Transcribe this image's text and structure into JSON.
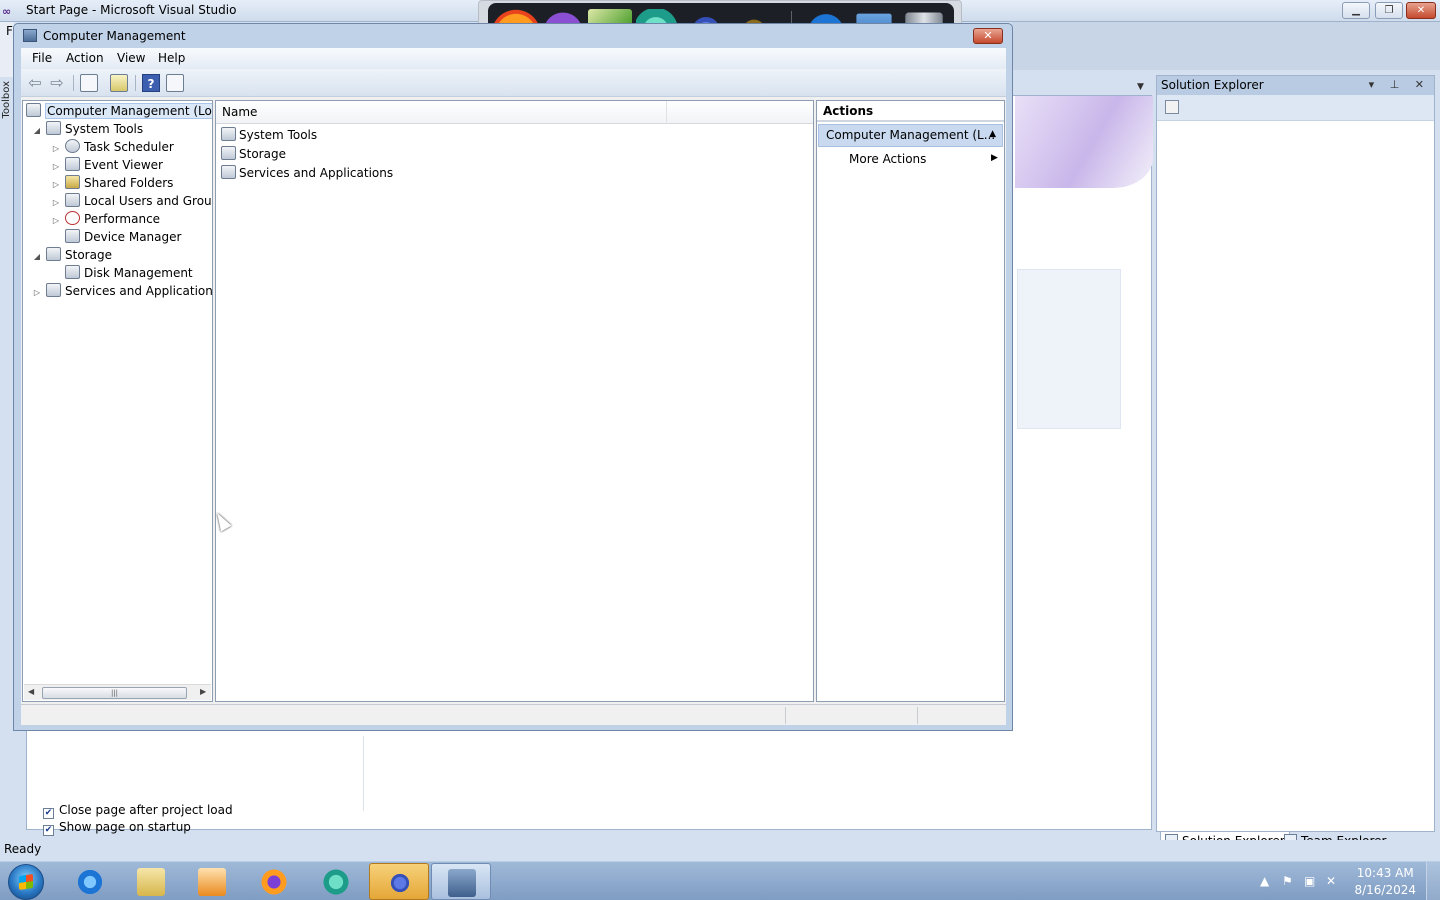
{
  "vs": {
    "title": "Start Page - Microsoft Visual Studio",
    "menu_letter": "F",
    "toolbox_label": "Toolbox",
    "status": "Ready",
    "start_page": {
      "checkbox_close": "Close page after project load",
      "checkbox_show": "Show page on startup"
    },
    "solution_explorer": {
      "title": "Solution Explorer",
      "tab_solution": "Solution Explorer",
      "tab_team": "Team Explorer"
    }
  },
  "computer_management": {
    "title": "Computer Management",
    "menu": [
      "File",
      "Action",
      "View",
      "Help"
    ],
    "tree": [
      {
        "label": "Computer Management (Local",
        "depth": 0,
        "expander": "",
        "icon": "computer-management-icon",
        "selected": true
      },
      {
        "label": "System Tools",
        "depth": 1,
        "expander": "◢",
        "icon": "system-tools-icon"
      },
      {
        "label": "Task Scheduler",
        "depth": 2,
        "expander": "▷",
        "icon": "task-scheduler-icon"
      },
      {
        "label": "Event Viewer",
        "depth": 2,
        "expander": "▷",
        "icon": "event-viewer-icon"
      },
      {
        "label": "Shared Folders",
        "depth": 2,
        "expander": "▷",
        "icon": "shared-folders-icon"
      },
      {
        "label": "Local Users and Groups",
        "depth": 2,
        "expander": "▷",
        "icon": "local-users-icon"
      },
      {
        "label": "Performance",
        "depth": 2,
        "expander": "▷",
        "icon": "performance-icon"
      },
      {
        "label": "Device Manager",
        "depth": 2,
        "expander": "",
        "icon": "device-manager-icon"
      },
      {
        "label": "Storage",
        "depth": 1,
        "expander": "◢",
        "icon": "storage-icon"
      },
      {
        "label": "Disk Management",
        "depth": 2,
        "expander": "",
        "icon": "disk-management-icon"
      },
      {
        "label": "Services and Applications",
        "depth": 1,
        "expander": "▷",
        "icon": "services-applications-icon"
      }
    ],
    "list": {
      "column_name": "Name",
      "items": [
        "System Tools",
        "Storage",
        "Services and Applications"
      ]
    },
    "actions": {
      "header": "Actions",
      "selected": "Computer Management (L...",
      "more": "More Actions"
    }
  },
  "taskbar": {
    "time": "10:43 AM",
    "date": "8/16/2024"
  },
  "colors": {
    "accent": "#3d5fb0",
    "selection": "#c9daf0",
    "taskbar": "#8faacc"
  }
}
